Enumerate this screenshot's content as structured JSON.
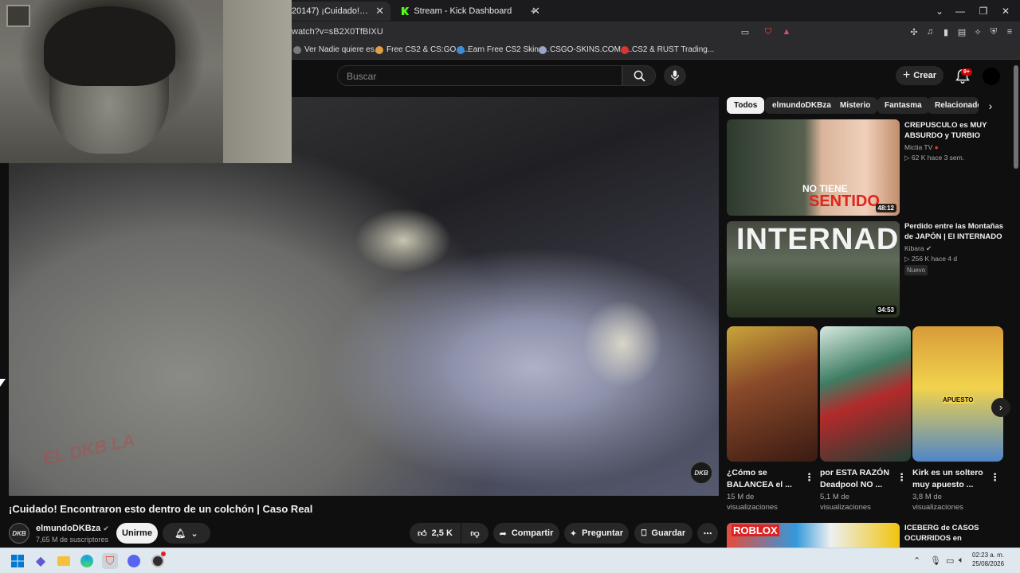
{
  "browser": {
    "tabs": [
      {
        "title": "20147) ¡Cuidado! Encontraron"
      },
      {
        "title": "Stream - Kick Dashboard"
      }
    ],
    "new_tab": "+",
    "url": "watch?v=sB2X0TfBIXU",
    "bookmarks": [
      "Ver Nadie quiere es...",
      "Free CS2 & CS:GO S...",
      "Earn Free CS2 Skins...",
      "CSGO-SKINS.COM -...",
      "CS2 & RUST Trading..."
    ]
  },
  "header": {
    "search_placeholder": "Buscar",
    "create_label": "Crear",
    "notif_count": "9+"
  },
  "video": {
    "title": "¡Cuidado! Encontraron esto dentro de un colchón | Caso Real",
    "channel_logo": "DKB",
    "watermark": "EL DKB LA"
  },
  "channel": {
    "name": "elmundoDKBza",
    "verified_icon": "verified-check-icon",
    "subscribers": "7,65 M de suscriptores",
    "join_label": "Unirme"
  },
  "actions": {
    "likes": "2,5 K",
    "share": "Compartir",
    "ask": "Preguntar",
    "save": "Guardar"
  },
  "chips": [
    "Todos",
    "elmundoDKBza",
    "Misterio",
    "Fantasma",
    "Relacionado"
  ],
  "related": [
    {
      "title": "CREPUSCULO es MUY ABSURDO y TURBIO",
      "channel": "Mictia TV",
      "meta": "62 K  hace 3 sem.",
      "duration": "48:12",
      "thumb_text_1": "NO TIENE",
      "thumb_text_2": "SENTIDO"
    },
    {
      "title": "Perdido entre las Montañas de JAPÓN | El INTERNADO",
      "channel": "Kibara",
      "meta": "256 K  hace 4 d",
      "badge": "Nuevo",
      "duration": "34:53",
      "thumb_text_1": "INTERNADO"
    },
    {
      "title": "ICEBERG de CASOS OCURRIDOS en",
      "thumb_text_1": "ROBLOX"
    }
  ],
  "shorts": [
    {
      "title": "¿Cómo se BALANCEA el ...",
      "views": "15 M de visualizaciones"
    },
    {
      "title": "por ESTA RAZÓN Deadpool NO ...",
      "views": "5,1 M de visualizaciones"
    },
    {
      "title": "Kirk es un soltero muy apuesto ...",
      "views": "3,8 M de visualizaciones",
      "thumb_text": "APUESTO"
    }
  ],
  "taskbar": {
    "time": "02:23 a. m.",
    "date": "25/08/2026"
  },
  "colors": {
    "background": "#0f0f0f",
    "chip_active": "#f1f1f1",
    "notif_badge": "#cc0000",
    "kick_green": "#53fc18",
    "taskbar": "#dfe8ef"
  }
}
